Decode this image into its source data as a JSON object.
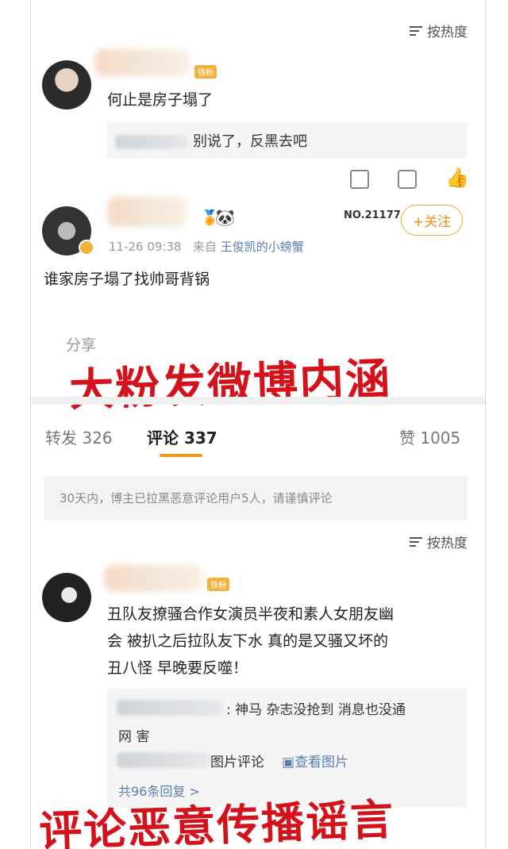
{
  "sort_label": "按热度",
  "comment1": {
    "badge": "铁粉",
    "text": "何止是房子塌了",
    "reply": "别说了，反黑去吧"
  },
  "post": {
    "timestamp": "11-26 09:38",
    "source_prefix": "来自",
    "source": "王俊凯的小螃蟹",
    "fans_no": "NO.21177",
    "follow_label": "+关注",
    "text": "谁家房子塌了找帅哥背锅",
    "share_label": "分享"
  },
  "overlay_top": "大粉发微博内涵",
  "tabs": {
    "repost": "转发 326",
    "comments": "评论 337",
    "likes": "赞 1005"
  },
  "notice": "30天内，博主已拉黑恶意评论用户5人，请谨慎评论",
  "sort_label2": "按热度",
  "comment2": {
    "badge": "铁粉",
    "text_line1": "丑队友撩骚合作女演员半夜和素人女朋友幽",
    "text_line2": "会 被扒之后拉队友下水 真的是又骚又坏的",
    "text_line3": "丑八怪 早晚要反噬！",
    "reply1": ": 神马 杂志没抢到 消息也没通",
    "reply1_cont": "网 害",
    "reply2": "图片评论",
    "view_image": "查看图片",
    "more_replies": "共96条回复 >"
  },
  "overlay_bottom": "评论恶意传播谣言",
  "colors": {
    "accent": "#f39a1a",
    "link": "#5a7fb5",
    "overlay": "#d3121b",
    "badge": "#f4b13b"
  }
}
